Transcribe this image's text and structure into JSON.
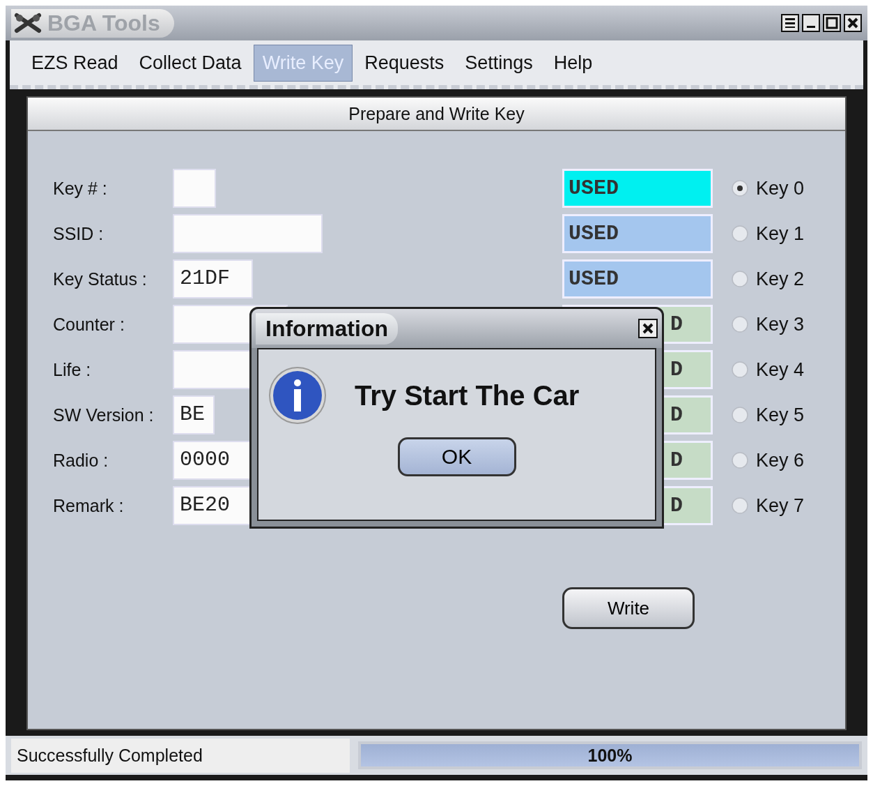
{
  "window": {
    "title": "BGA Tools"
  },
  "menu": [
    {
      "label": "EZS Read",
      "selected": false
    },
    {
      "label": "Collect Data",
      "selected": false
    },
    {
      "label": "Write Key",
      "selected": true
    },
    {
      "label": "Requests",
      "selected": false
    },
    {
      "label": "Settings",
      "selected": false
    },
    {
      "label": "Help",
      "selected": false
    }
  ],
  "panel": {
    "title": "Prepare and Write Key"
  },
  "fields": [
    {
      "label": "Key # :"
    },
    {
      "label": "SSID :"
    },
    {
      "label": "Key Status :",
      "value": "21DF"
    },
    {
      "label": "Counter :"
    },
    {
      "label": "Life :"
    },
    {
      "label": "SW Version :",
      "value": "BE"
    },
    {
      "label": "Radio :",
      "value": "0000"
    },
    {
      "label": "Remark :",
      "value": "BE20"
    }
  ],
  "keys": [
    {
      "status": "USED",
      "color": "#00f0f0",
      "label": "Key 0",
      "selected": true
    },
    {
      "status": "USED",
      "color": "#a4c6ee",
      "label": "Key 1",
      "selected": false
    },
    {
      "status": "USED",
      "color": "#a4c6ee",
      "label": "Key 2",
      "selected": false
    },
    {
      "status": "D",
      "color": "#c6dcc6",
      "label": "Key 3",
      "selected": false,
      "kind": "covered"
    },
    {
      "status": "D",
      "color": "#c6dcc6",
      "label": "Key 4",
      "selected": false,
      "kind": "covered"
    },
    {
      "status": "D",
      "color": "#c6dcc6",
      "label": "Key 5",
      "selected": false,
      "kind": "covered"
    },
    {
      "status": "D",
      "color": "#c6dcc6",
      "label": "Key 6",
      "selected": false,
      "kind": "covered"
    },
    {
      "status": "D",
      "color": "#c6dcc6",
      "label": "Key 7",
      "selected": false,
      "kind": "covered"
    }
  ],
  "write_button": "Write",
  "dialog": {
    "title": "Information",
    "message": "Try Start The Car",
    "button": "OK"
  },
  "status_bar": {
    "message": "Successfully Completed",
    "progress": {
      "level": 1,
      "reading": "100%"
    }
  }
}
